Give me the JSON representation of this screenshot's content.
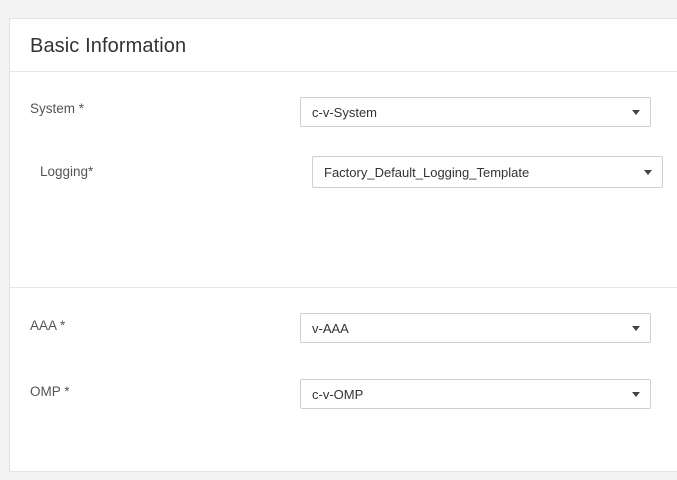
{
  "card": {
    "title": "Basic Information"
  },
  "fields": {
    "system": {
      "label": "System *",
      "value": "c-v-System"
    },
    "logging": {
      "label": "Logging*",
      "value": "Factory_Default_Logging_Template"
    },
    "aaa": {
      "label": "AAA *",
      "value": "v-AAA"
    },
    "omp": {
      "label": "OMP *",
      "value": "c-v-OMP"
    }
  },
  "icons": {
    "dropdown": "caret-down-icon"
  }
}
